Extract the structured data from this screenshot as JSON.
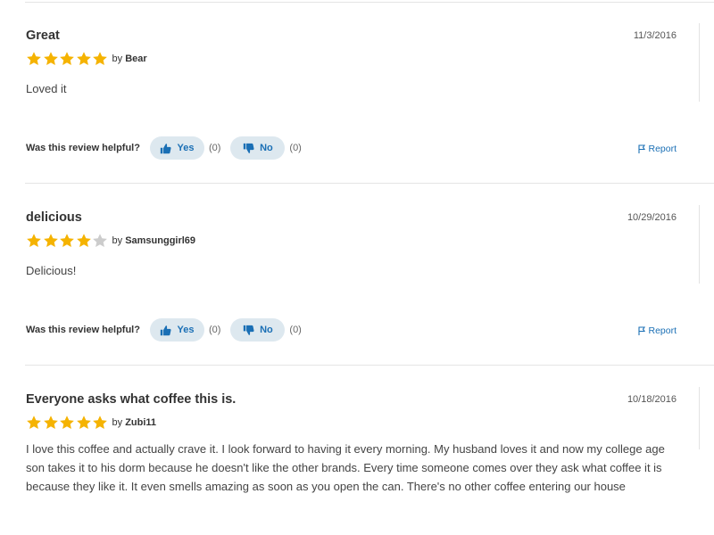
{
  "colors": {
    "star_filled": "#f5b301",
    "star_empty": "#cccccc",
    "accent": "#1a6fb5",
    "button_bg": "#dde8ef"
  },
  "helpful_question": "Was this review helpful?",
  "yes_label": "Yes",
  "no_label": "No",
  "report_label": "Report",
  "by_prefix": "by",
  "reviews": [
    {
      "title": "Great",
      "date": "11/3/2016",
      "rating": 5,
      "author": "Bear",
      "body": "Loved it",
      "yes_count": "(0)",
      "no_count": "(0)"
    },
    {
      "title": "delicious",
      "date": "10/29/2016",
      "rating": 4,
      "author": "Samsunggirl69",
      "body": "Delicious!",
      "yes_count": "(0)",
      "no_count": "(0)"
    },
    {
      "title": "Everyone asks what coffee this is.",
      "date": "10/18/2016",
      "rating": 5,
      "author": "Zubi11",
      "body": "I love this coffee and actually crave it. I look forward to having it every morning. My husband loves it and now my college age son takes it to his dorm because he doesn't like the other brands. Every time someone comes over they ask what coffee it is because they like it. It even smells amazing as soon as you open the can. There's no other coffee entering our house",
      "yes_count": "",
      "no_count": ""
    }
  ]
}
